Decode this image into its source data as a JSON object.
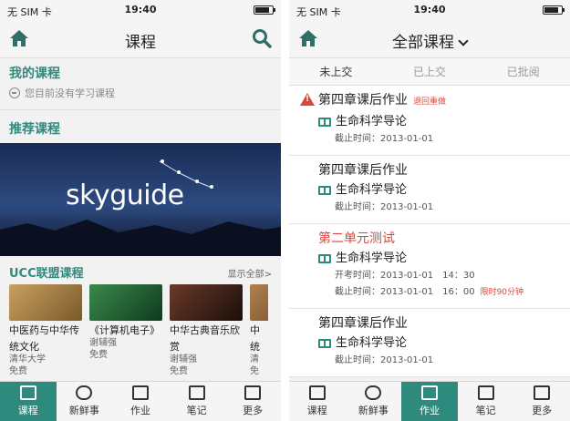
{
  "status": {
    "carrier": "无 SIM 卡",
    "time": "19:40"
  },
  "left": {
    "title": "课程",
    "my_courses": {
      "title": "我的课程",
      "empty": "您目前没有学习课程"
    },
    "recommended": {
      "title": "推荐课程",
      "banner_text": "skyguide"
    },
    "ucc": {
      "title": "UCC联盟课程",
      "show_all": "显示全部>",
      "cards": [
        {
          "name_l1": "中医药与中华传",
          "name_l2": "统文化",
          "author": "清华大学",
          "price": "免费"
        },
        {
          "name_l1": "《计算机电子》",
          "name_l2": "",
          "author": "谢辅强",
          "price": "免费"
        },
        {
          "name_l1": "中华古典音乐欣",
          "name_l2": "赏",
          "author": "谢辅强",
          "price": "免费"
        },
        {
          "name_l1": "中",
          "name_l2": "统",
          "author": "清",
          "price": "免"
        }
      ]
    },
    "tabs": [
      "课程",
      "新鲜事",
      "作业",
      "笔记",
      "更多"
    ]
  },
  "right": {
    "title": "全部课程",
    "segments": [
      "未上交",
      "已上交",
      "已批阅"
    ],
    "items": [
      {
        "title": "第四章课后作业",
        "tag": "退回重做",
        "course": "生命科学导论",
        "line1": "截止时间：2013-01-01",
        "line2": "",
        "extra": ""
      },
      {
        "title": "第四章课后作业",
        "tag": "",
        "course": "生命科学导论",
        "line1": "截止时间：2013-01-01",
        "line2": "",
        "extra": ""
      },
      {
        "title": "第二单元测试",
        "tag": "",
        "course": "生命科学导论",
        "line1": "开考时间：2013-01-01　14：30",
        "line2": "截止时间：2013-01-01　16：00",
        "extra": "限时90分钟"
      },
      {
        "title": "第四章课后作业",
        "tag": "",
        "course": "生命科学导论",
        "line1": "截止时间：2013-01-01",
        "line2": "",
        "extra": ""
      }
    ],
    "tabs": [
      "课程",
      "新鲜事",
      "作业",
      "笔记",
      "更多"
    ]
  },
  "colors": {
    "accent": "#2f8a7e",
    "alert": "#d9473b"
  }
}
